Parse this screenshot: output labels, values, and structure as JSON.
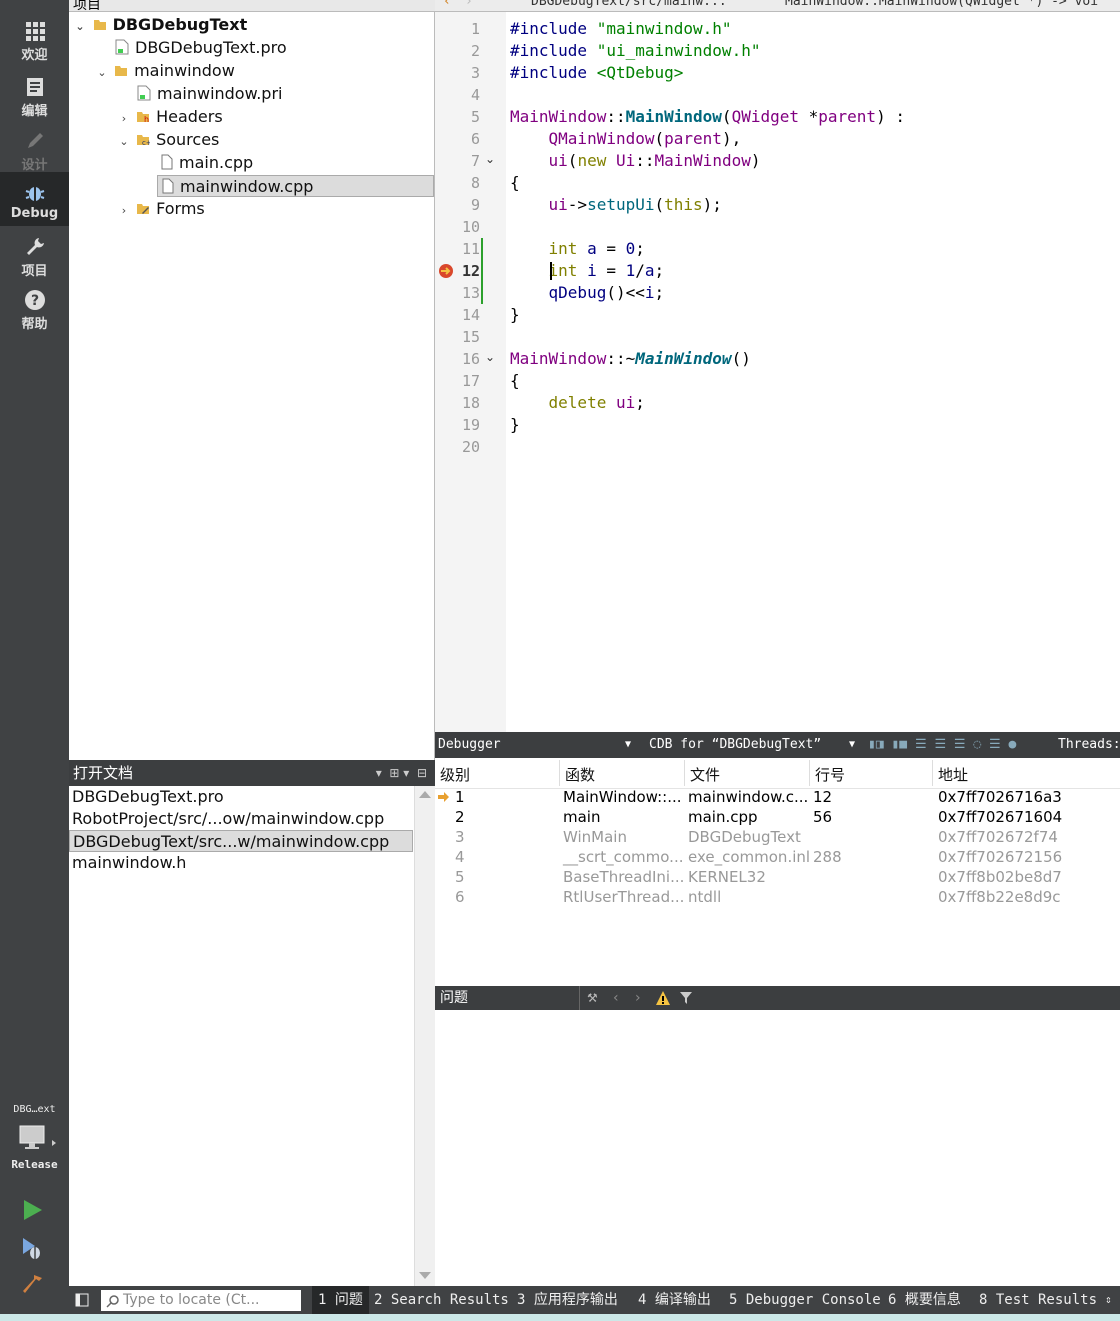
{
  "modes": [
    {
      "label": "欢迎",
      "icon": "grid-icon",
      "state": "normal"
    },
    {
      "label": "编辑",
      "icon": "edit-doc-icon",
      "state": "normal"
    },
    {
      "label": "设计",
      "icon": "pencil-icon",
      "state": "disabled"
    },
    {
      "label": "Debug",
      "icon": "bug-icon",
      "state": "active"
    },
    {
      "label": "项目",
      "icon": "wrench-icon",
      "state": "normal"
    },
    {
      "label": "帮助",
      "icon": "help-icon",
      "state": "normal"
    }
  ],
  "kit": {
    "name": "DBG…ext",
    "mode": "Release"
  },
  "project_panel": {
    "title": "项目",
    "tree": [
      "DBGDebugText",
      "DBGDebugText.pro",
      "mainwindow",
      "mainwindow.pri",
      "Headers",
      "Sources",
      "main.cpp",
      "mainwindow.cpp",
      "Forms"
    ]
  },
  "open_docs": {
    "title": "打开文档",
    "items": [
      "DBGDebugText.pro",
      "RobotProject/src/...ow/mainwindow.cpp",
      "DBGDebugText/src...w/mainwindow.cpp",
      "mainwindow.h"
    ]
  },
  "editor": {
    "file_path": "DBGDebugText/src/mainw...",
    "symbol": "MainWindow::MainWindow(QWidget *) -> voi",
    "current_line": 12,
    "breakpoint_line": 12,
    "line_numbers": [
      "1",
      "2",
      "3",
      "4",
      "5",
      "6",
      "7",
      "8",
      "9",
      "10",
      "11",
      "12",
      "13",
      "14",
      "15",
      "16",
      "17",
      "18",
      "19",
      "20"
    ]
  },
  "debugger": {
    "label": "Debugger",
    "engine": "CDB for “DBGDebugText”",
    "threads": "Threads:",
    "columns": [
      "级别",
      "函数",
      "文件",
      "行号",
      "地址"
    ],
    "frames": [
      {
        "level": "1",
        "function": "MainWindow::...",
        "file": "mainwindow.c...",
        "line": "12",
        "address": "0x7ff7026716a3",
        "dim": false
      },
      {
        "level": "2",
        "function": "main",
        "file": "main.cpp",
        "line": "56",
        "address": "0x7ff702671604",
        "dim": false
      },
      {
        "level": "3",
        "function": "WinMain",
        "file": "DBGDebugText",
        "line": "",
        "address": "0x7ff702672f74",
        "dim": true
      },
      {
        "level": "4",
        "function": "__scrt_commo...",
        "file": "exe_common.inl",
        "line": "288",
        "address": "0x7ff702672156",
        "dim": true
      },
      {
        "level": "5",
        "function": "BaseThreadIni...",
        "file": "KERNEL32",
        "line": "",
        "address": "0x7ff8b02be8d7",
        "dim": true
      },
      {
        "level": "6",
        "function": "RtlUserThread...",
        "file": "ntdll",
        "line": "",
        "address": "0x7ff8b22e8d9c",
        "dim": true
      }
    ]
  },
  "issues": {
    "title": "问题"
  },
  "statusbar": {
    "locator_placeholder": "Type to locate (Ct...",
    "tabs": [
      "1 问题",
      "2 Search Results",
      "3 应用程序输出",
      "4 编译输出",
      "5 Debugger Console",
      "6 概要信息",
      "8 Test Results"
    ]
  }
}
